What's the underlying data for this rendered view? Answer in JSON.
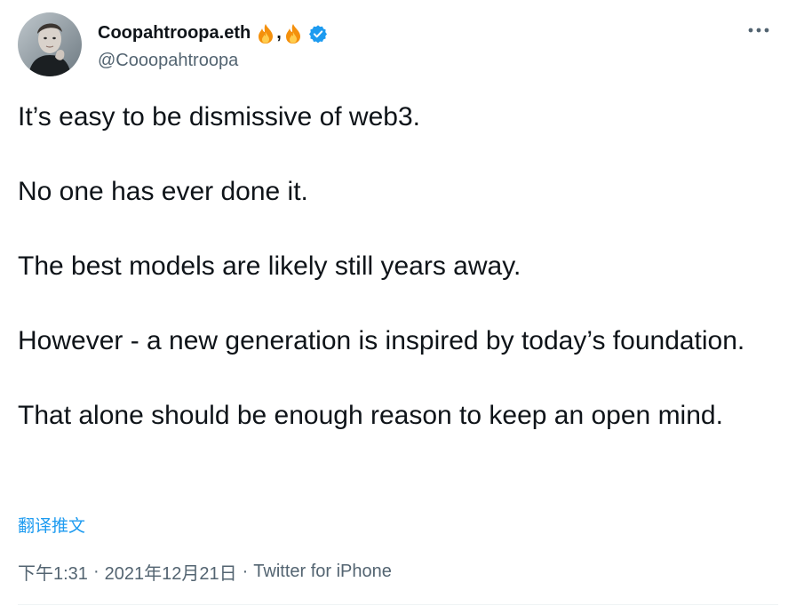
{
  "author": {
    "display_name": "Coopahtroopa.eth",
    "name_emoji_separator": ",",
    "handle": "@Cooopahtroopa",
    "verified": true
  },
  "icons": {
    "avatar": "avatar",
    "emoji": "fire-emoji",
    "verified": "verified-badge-icon",
    "more": "more-options-icon"
  },
  "colors": {
    "text": "#0f1419",
    "secondary": "#536471",
    "accent": "#1d9bf0"
  },
  "tweet": {
    "paragraphs": [
      "It’s easy to be dismissive of web3.",
      "No one has ever done it.",
      "The best models are likely still years away.",
      "However - a new generation is inspired by today’s foundation.",
      "That alone should be enough reason to keep an open mind."
    ],
    "translate_label": "翻译推文",
    "time": "下午1:31",
    "date": "2021年12月21日",
    "separator": "·",
    "source": "Twitter for iPhone"
  }
}
